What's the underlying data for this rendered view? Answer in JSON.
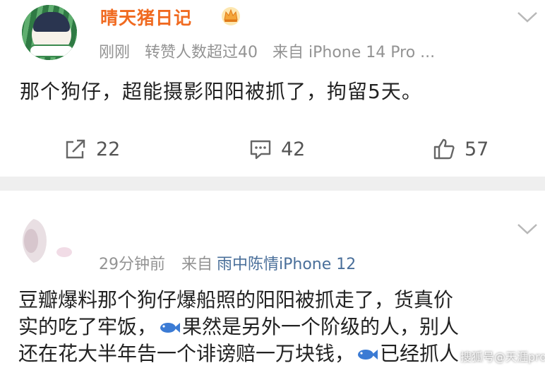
{
  "post1": {
    "username": "晴天猪日记",
    "time": "刚刚",
    "reposts_note": "转赞人数超过40",
    "source": "来自 iPhone 14 Pro ...",
    "text": "那个狗仔，超能摄影阳阳被抓了，拘留5天。",
    "actions": {
      "repost_count": "22",
      "comment_count": "42",
      "like_count": "57"
    }
  },
  "post2": {
    "time": "29分钟前",
    "source_prefix": "来自",
    "source_name": "雨中陈情iPhone 12",
    "text_line1": "豆瓣爆料那个狗仔爆船照的阳阳被抓走了，货真价",
    "text_line2_a": "实的吃了牢饭，",
    "text_line2_b": "果然是另外一个阶级的人，别人",
    "text_line3_a": "还在花大半年告一个诽谤赔一万块钱，",
    "text_line3_b": "已经抓人"
  },
  "watermark": "搜狐号@天涯pro",
  "colors": {
    "username": "#f06a20",
    "meta": "#939393",
    "source_link": "#4a6f9a",
    "divider": "#efefef"
  },
  "icons": {
    "crown": "crown-icon",
    "chevron": "chevron-down-icon",
    "repost": "repost-icon",
    "comment": "comment-icon",
    "like": "thumbs-up-icon",
    "fish": "fish-emoji"
  }
}
